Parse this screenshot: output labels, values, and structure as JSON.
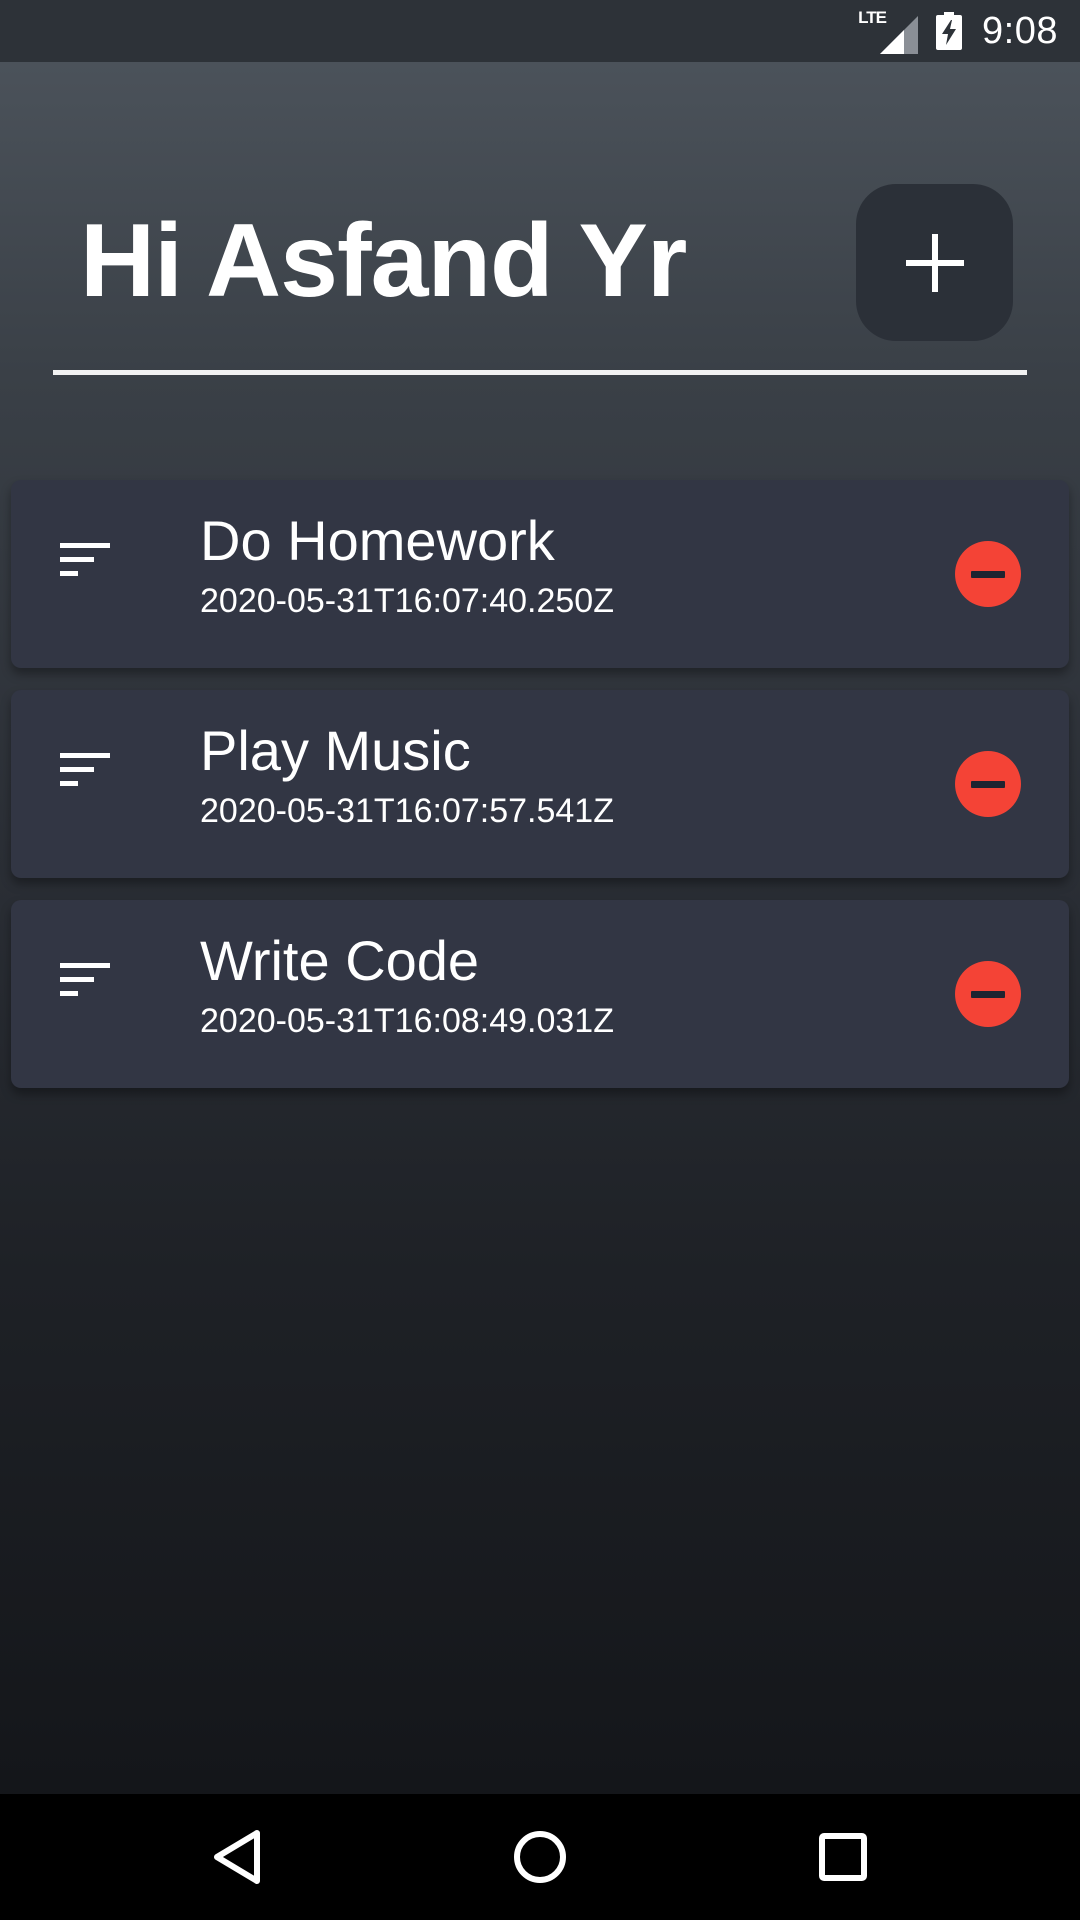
{
  "status_bar": {
    "network": "LTE",
    "time": "9:08",
    "icons": [
      "signal-icon",
      "battery-charging-icon"
    ]
  },
  "header": {
    "greeting": "Hi Asfand Yr",
    "add_button_icon": "plus-icon"
  },
  "tasks": [
    {
      "title": "Do Homework",
      "date": "2020-05-31T16:07:40.250Z"
    },
    {
      "title": "Play Music",
      "date": "2020-05-31T16:07:57.541Z"
    },
    {
      "title": "Write Code",
      "date": "2020-05-31T16:08:49.031Z"
    }
  ],
  "nav_bar": {
    "icons": [
      "back-icon",
      "home-icon",
      "recents-icon"
    ]
  },
  "colors": {
    "card": "#323644",
    "remove": "#f44336",
    "add_button": "#2b3038"
  }
}
